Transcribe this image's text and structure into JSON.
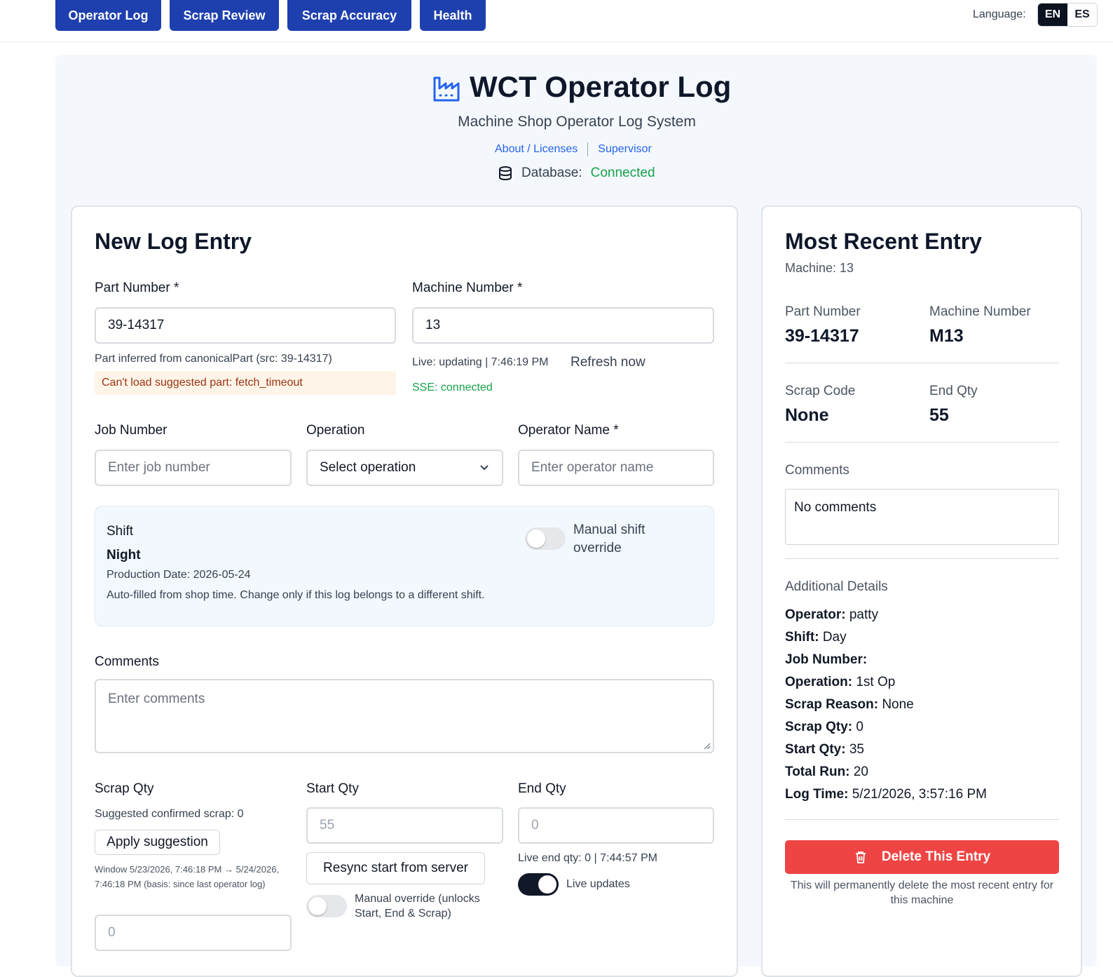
{
  "nav": {
    "tabs": [
      "Operator Log",
      "Scrap Review",
      "Scrap Accuracy",
      "Health"
    ],
    "language_label": "Language:",
    "lang_en": "EN",
    "lang_es": "ES"
  },
  "header": {
    "icon": "factory-icon",
    "title": "WCT Operator Log",
    "subtitle": "Machine Shop Operator Log System",
    "link_about": "About / Licenses",
    "link_supervisor": "Supervisor",
    "db_label": "Database:",
    "db_status": "Connected"
  },
  "form": {
    "heading": "New Log Entry",
    "part_label": "Part Number *",
    "part_value": "39-14317",
    "part_inferred": "Part inferred from canonicalPart (src: 39-14317)",
    "part_warning": "Can't load suggested part: fetch_timeout",
    "machine_label": "Machine Number *",
    "machine_value": "13",
    "live_status": "Live: updating | 7:46:19 PM",
    "refresh_label": "Refresh now",
    "sse_status": "SSE: connected",
    "job_label": "Job Number",
    "job_placeholder": "Enter job number",
    "operation_label": "Operation",
    "operation_value": "Select operation",
    "operator_label": "Operator Name *",
    "operator_placeholder": "Enter operator name",
    "shift": {
      "label": "Shift",
      "value": "Night",
      "production_date_label": "Production Date:",
      "production_date": "2026-05-24",
      "note": "Auto-filled from shop time. Change only if this log belongs to a different shift.",
      "manual_override_label": "Manual shift override",
      "manual_override_on": false
    },
    "comments_label": "Comments",
    "comments_placeholder": "Enter comments",
    "scrap_label": "Scrap Qty",
    "scrap_suggested": "Suggested confirmed scrap: 0",
    "apply_suggestion": "Apply suggestion",
    "window_note": "Window 5/23/2026, 7:46:18 PM → 5/24/2026, 7:46:18 PM (basis: since last operator log)",
    "scrap_placeholder": "0",
    "start_label": "Start Qty",
    "start_value": "55",
    "resync_label": "Resync start from server",
    "manual_override_label": "Manual override (unlocks Start, End & Scrap)",
    "manual_override_on": false,
    "end_label": "End Qty",
    "end_placeholder": "0",
    "live_end": "Live end qty: 0 | 7:44:57 PM",
    "live_updates_label": "Live updates",
    "live_updates_on": true
  },
  "recent": {
    "heading": "Most Recent Entry",
    "machine_sub": "Machine: 13",
    "part_label": "Part Number",
    "part_value": "39-14317",
    "machine_label": "Machine Number",
    "machine_value": "M13",
    "scrap_code_label": "Scrap Code",
    "scrap_code_value": "None",
    "end_qty_label": "End Qty",
    "end_qty_value": "55",
    "comments_label": "Comments",
    "comments_value": "No comments",
    "details_heading": "Additional Details",
    "details": [
      {
        "k": "Operator:",
        "v": "patty"
      },
      {
        "k": "Shift:",
        "v": "Day"
      },
      {
        "k": "Job Number:",
        "v": ""
      },
      {
        "k": "Operation:",
        "v": "1st Op"
      },
      {
        "k": "Scrap Reason:",
        "v": "None"
      },
      {
        "k": "Scrap Qty:",
        "v": "0"
      },
      {
        "k": "Start Qty:",
        "v": "35"
      },
      {
        "k": "Total Run:",
        "v": "20"
      },
      {
        "k": "Log Time:",
        "v": "5/21/2026, 3:57:16 PM"
      }
    ],
    "delete_label": "Delete This Entry",
    "delete_note": "This will permanently delete the most recent entry for this machine"
  },
  "colors": {
    "nav": "#1e40af",
    "connected": "#16a34a",
    "delete": "#ef4444"
  }
}
